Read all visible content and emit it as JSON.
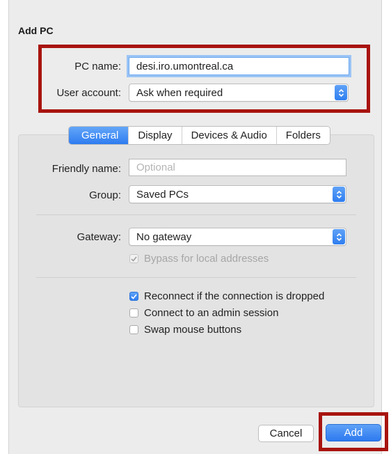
{
  "dialog": {
    "title": "Add PC"
  },
  "connection": {
    "pc_name_label": "PC name:",
    "pc_name_value": "desi.iro.umontreal.ca",
    "user_account_label": "User account:",
    "user_account_value": "Ask when required"
  },
  "tabs": [
    {
      "label": "General",
      "active": true
    },
    {
      "label": "Display",
      "active": false
    },
    {
      "label": "Devices & Audio",
      "active": false
    },
    {
      "label": "Folders",
      "active": false
    }
  ],
  "general": {
    "friendly_name_label": "Friendly name:",
    "friendly_name_placeholder": "Optional",
    "group_label": "Group:",
    "group_value": "Saved PCs",
    "gateway_label": "Gateway:",
    "gateway_value": "No gateway",
    "bypass_label": "Bypass for local addresses",
    "bypass_checked": true,
    "bypass_enabled": false,
    "reconnect_label": "Reconnect if the connection is dropped",
    "reconnect_checked": true,
    "admin_label": "Connect to an admin session",
    "admin_checked": false,
    "swap_label": "Swap mouse buttons",
    "swap_checked": false
  },
  "footer": {
    "cancel_label": "Cancel",
    "add_label": "Add"
  },
  "colors": {
    "accent": "#2f7ef0",
    "highlight_box": "#a8140f"
  }
}
